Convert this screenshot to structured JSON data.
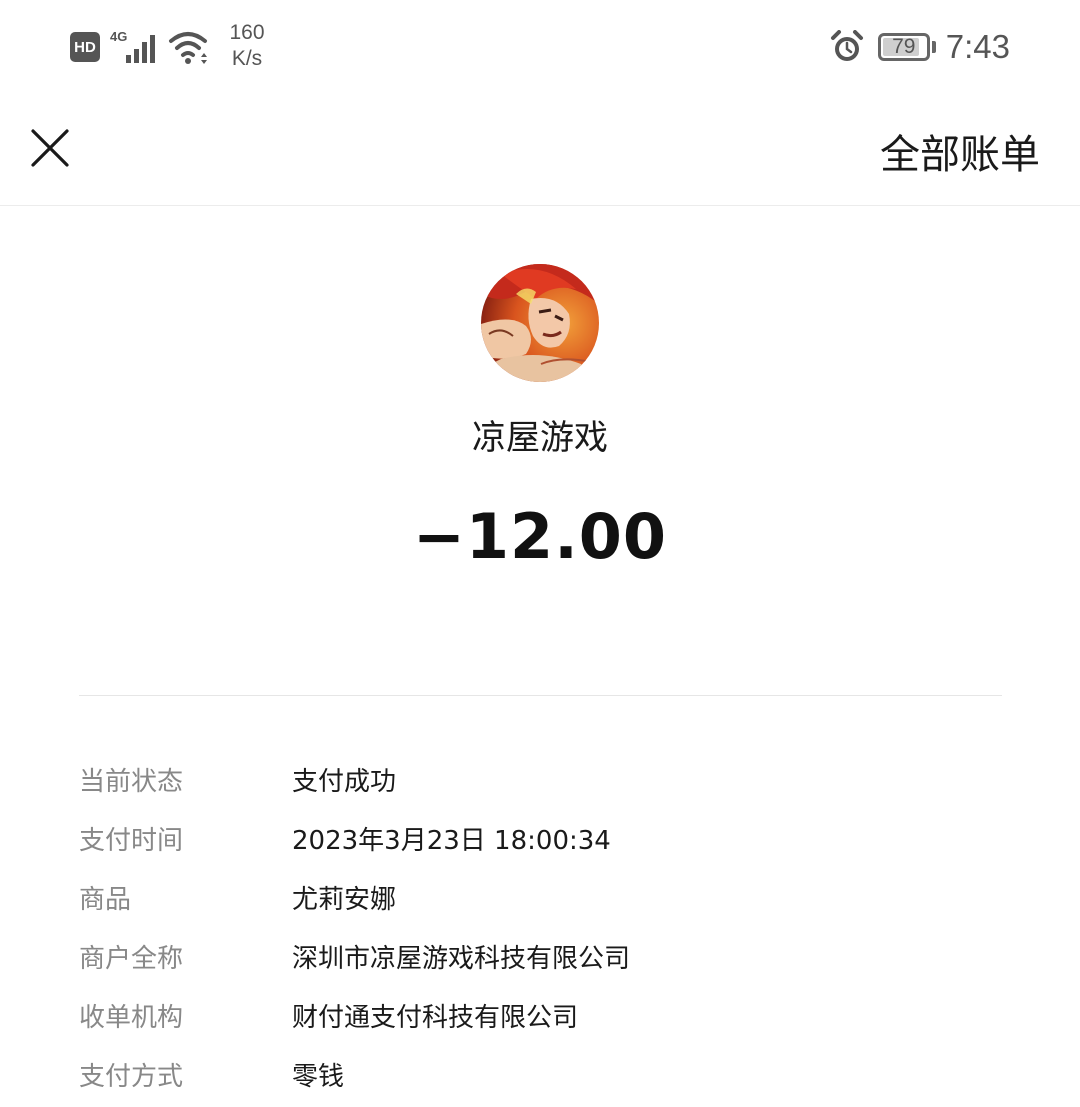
{
  "status_bar": {
    "hd_label": "HD",
    "network_type": "4G",
    "net_speed_value": "160",
    "net_speed_unit": "K/s",
    "battery_level": "79",
    "time": "7:43"
  },
  "nav": {
    "close_icon": "close-icon",
    "all_bills_label": "全部账单"
  },
  "transaction": {
    "merchant_name": "凉屋游戏",
    "amount": "−12.00"
  },
  "details": [
    {
      "label": "当前状态",
      "value": "支付成功"
    },
    {
      "label": "支付时间",
      "value": "2023年3月23日 18:00:34"
    },
    {
      "label": "商品",
      "value": "尤莉安娜"
    },
    {
      "label": "商户全称",
      "value": "深圳市凉屋游戏科技有限公司"
    },
    {
      "label": "收单机构",
      "value": "财付通支付科技有限公司"
    },
    {
      "label": "支付方式",
      "value": "零钱"
    }
  ],
  "colors": {
    "label_gray": "#888888",
    "text_dark": "#1a1a1a",
    "divider": "#e6e6e6"
  }
}
